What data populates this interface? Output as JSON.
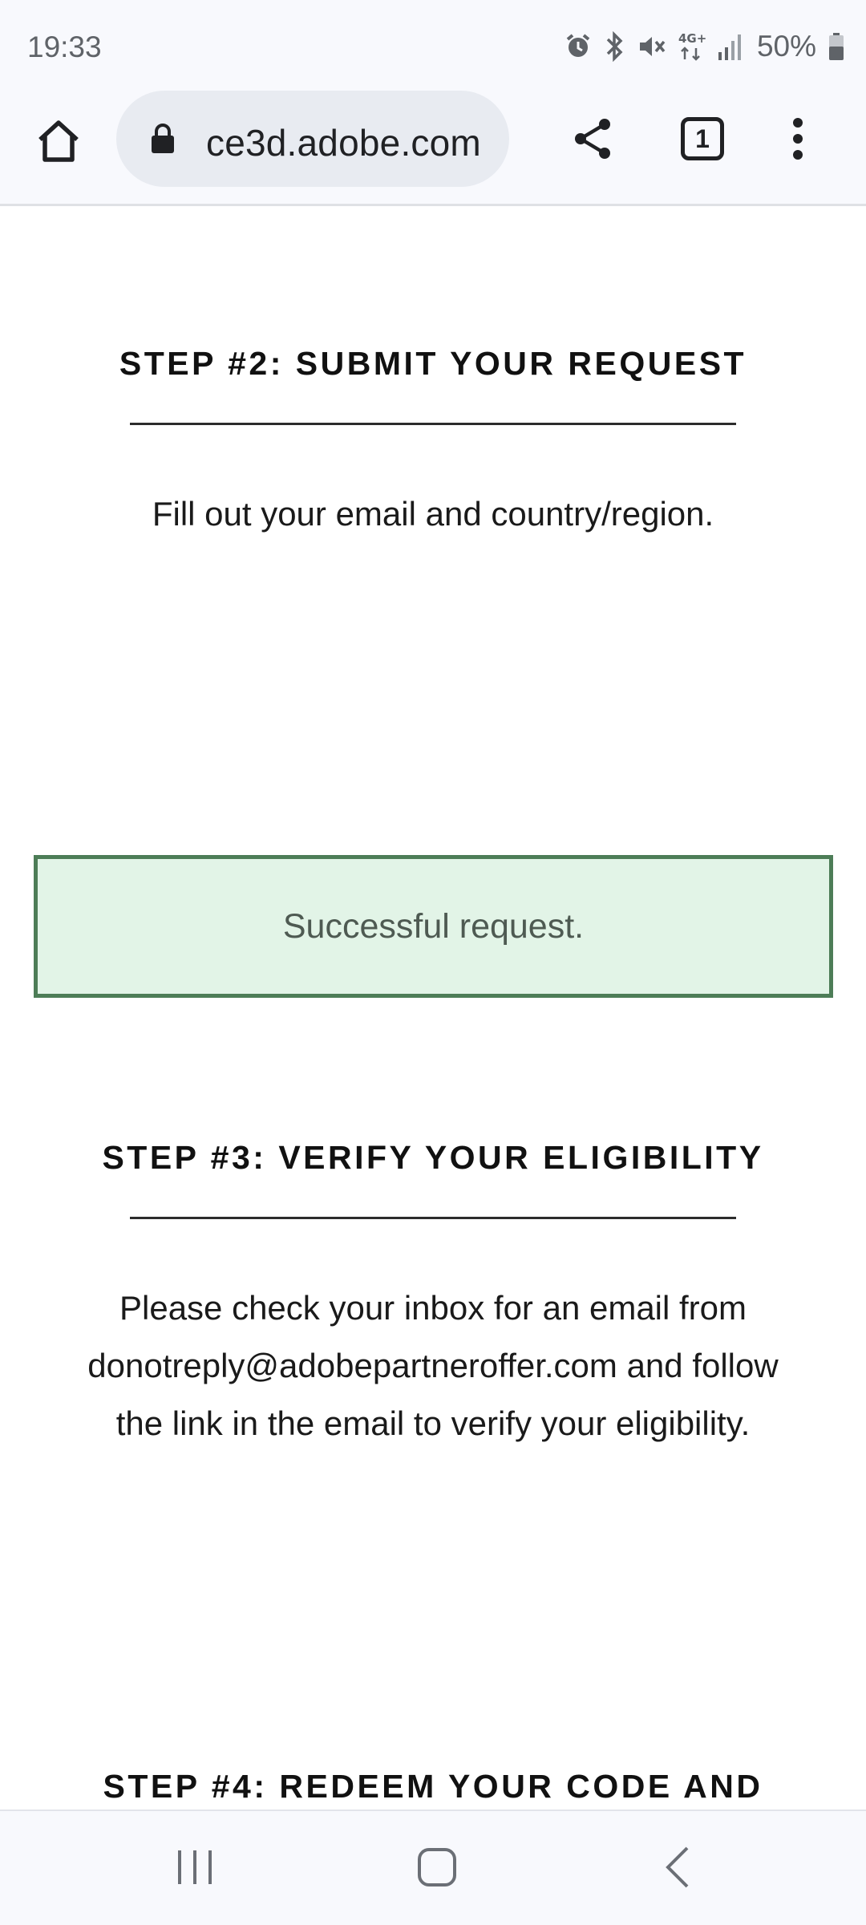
{
  "status_bar": {
    "time": "19:33",
    "icons": [
      "alarm-icon",
      "bluetooth-icon",
      "mute-icon",
      "4g-icon",
      "signal-icon",
      "battery-icon"
    ],
    "network_label": "4G+",
    "battery": "50%"
  },
  "browser": {
    "url": "ce3d.adobe.com",
    "tab_count": "1",
    "icons": [
      "home-icon",
      "lock-icon",
      "share-icon",
      "tabs-icon",
      "more-vert-icon"
    ]
  },
  "content": {
    "step2": {
      "heading": "STEP #2: SUBMIT YOUR REQUEST",
      "text": "Fill out your email and country/region."
    },
    "alert": {
      "message": "Successful request.",
      "background": "#e2f4e7",
      "border": "#4d7d57"
    },
    "step3": {
      "heading": "STEP #3: VERIFY YOUR ELIGIBILITY",
      "text_lines": [
        "Please check your inbox for an email from",
        "donotreply@adobepartneroffer.com and follow",
        "the link in the email to verify your eligibility."
      ]
    },
    "step4": {
      "heading": "STEP #4: REDEEM YOUR CODE AND"
    }
  },
  "nav_bar": {
    "icons": [
      "recents-icon",
      "home-circle-icon",
      "back-icon"
    ]
  }
}
